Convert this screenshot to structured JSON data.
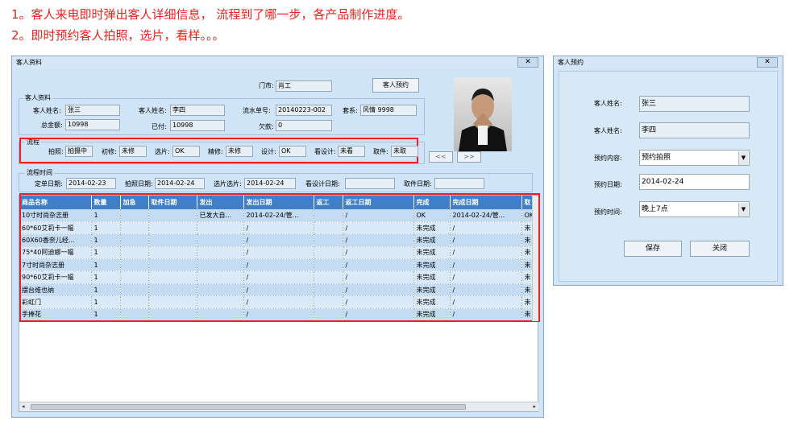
{
  "captions": [
    "1。客人来电即时弹出客人详细信息， 流程到了哪一步，各产品制作进度。",
    "2。即时预约客人拍照，选片，看样。。。"
  ],
  "main_window": {
    "title": "客人资料",
    "close": "✕",
    "store_label": "门市:",
    "store_value": "肖工",
    "reserve_button": "客人预约",
    "info_group": "客人资料",
    "customer_name_label": "客人姓名:",
    "customer_name_value": "张三",
    "customer_name2_label": "客人姓名:",
    "customer_name2_value": "李四",
    "serial_label": "流水单号:",
    "serial_value": "20140223-002",
    "package_label": "套系:",
    "package_value": "风情 9998",
    "total_label": "总金额:",
    "total_value": "10998",
    "paid_label": "已付:",
    "paid_value": "10998",
    "owed_label": "欠款:",
    "owed_value": "0",
    "process_group": "流程",
    "process": [
      {
        "label": "拍照:",
        "value": "拍摄中"
      },
      {
        "label": "初修:",
        "value": "未修"
      },
      {
        "label": "选片:",
        "value": "OK"
      },
      {
        "label": "精修:",
        "value": "未修"
      },
      {
        "label": "设计:",
        "value": "OK"
      },
      {
        "label": "看设计:",
        "value": "未看"
      },
      {
        "label": "取件:",
        "value": "未取"
      }
    ],
    "time_group": "流程时间",
    "times": [
      {
        "label": "定单日期:",
        "value": "2014-02-23"
      },
      {
        "label": "拍照日期:",
        "value": "2014-02-24"
      },
      {
        "label": "选片选片:",
        "value": "2014-02-24"
      },
      {
        "label": "看设计日期:",
        "value": ""
      },
      {
        "label": "取件日期:",
        "value": ""
      }
    ],
    "photo_prev": "<<",
    "photo_next": ">>",
    "grid": {
      "columns": [
        "商品名称",
        "数量",
        "加急",
        "取件日期",
        "发出",
        "发出日期",
        "返工",
        "返工日期",
        "完成",
        "完成日期",
        "取"
      ],
      "rows": [
        [
          "10寸时尚杂志册",
          "1",
          "",
          "",
          "已发大自...",
          "2014-02-24/管...",
          "",
          "/",
          "OK",
          "2014-02-24/管...",
          "OK"
        ],
        [
          "60*60艾莉卡一幅",
          "1",
          "",
          "",
          "",
          "/",
          "",
          "/",
          "未完成",
          "/",
          "未"
        ],
        [
          "60X60香奈儿经...",
          "1",
          "",
          "",
          "",
          "/",
          "",
          "/",
          "未完成",
          "/",
          "未"
        ],
        [
          "75*40阿迪娜一幅",
          "1",
          "",
          "",
          "",
          "/",
          "",
          "/",
          "未完成",
          "/",
          "未"
        ],
        [
          "7寸时尚杂志册",
          "1",
          "",
          "",
          "",
          "/",
          "",
          "/",
          "未完成",
          "/",
          "未"
        ],
        [
          "90*60艾莉卡一幅",
          "1",
          "",
          "",
          "",
          "/",
          "",
          "/",
          "未完成",
          "/",
          "未"
        ],
        [
          "摆台维也纳",
          "1",
          "",
          "",
          "",
          "/",
          "",
          "/",
          "未完成",
          "/",
          "未"
        ],
        [
          "彩虹门",
          "1",
          "",
          "",
          "",
          "/",
          "",
          "/",
          "未完成",
          "/",
          "未"
        ],
        [
          "手捧花",
          "1",
          "",
          "",
          "",
          "/",
          "",
          "/",
          "未完成",
          "/",
          "未"
        ]
      ]
    }
  },
  "reserve_window": {
    "title": "客人预约",
    "close": "✕",
    "name1_label": "客人姓名:",
    "name1_value": "张三",
    "name2_label": "客人姓名:",
    "name2_value": "李四",
    "content_label": "预约内容:",
    "content_value": "预约拍照",
    "date_label": "预约日期:",
    "date_value": "2014-02-24",
    "time_label": "预约时间:",
    "time_value": "晚上7点",
    "save_button": "保存",
    "close_button": "关闭"
  },
  "colors": {
    "caption": "#e8231f",
    "highlight": "#e8231f",
    "grid_header": "#3e7fc7",
    "window_bg": "#cfe4f6"
  }
}
